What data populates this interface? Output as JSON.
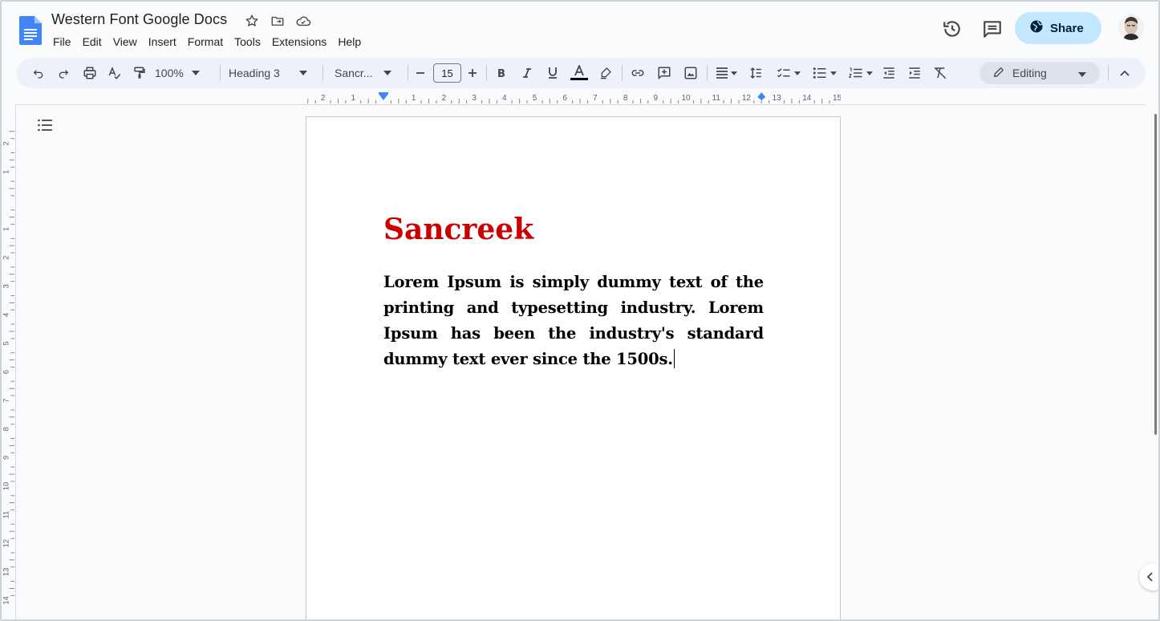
{
  "document": {
    "title": "Western Font Google Docs",
    "heading": "Sancreek",
    "body": "Lorem Ipsum is simply dummy text of the printing and typesetting industry. Lorem Ipsum has been the industry's standard dummy text ever since the 1500s."
  },
  "menu": [
    "File",
    "Edit",
    "View",
    "Insert",
    "Format",
    "Tools",
    "Extensions",
    "Help"
  ],
  "header": {
    "share_label": "Share",
    "icons": [
      "star-icon",
      "move-to-folder-icon",
      "cloud-saved-icon",
      "version-history-icon",
      "comments-icon"
    ]
  },
  "toolbar": {
    "zoom": "100%",
    "style": "Heading 3",
    "font": "Sancr...",
    "font_size": "15",
    "mode": "Editing"
  },
  "ruler": {
    "h_ticks": [
      "2",
      "1",
      "1",
      "2",
      "3",
      "4",
      "5",
      "6",
      "7",
      "8",
      "9",
      "10",
      "11",
      "12",
      "13",
      "14",
      "15"
    ],
    "v_ticks": [
      "2",
      "1",
      "1",
      "2",
      "3",
      "4",
      "5",
      "6",
      "7",
      "8",
      "9",
      "10",
      "11",
      "12",
      "13",
      "14"
    ]
  },
  "colors": {
    "heading": "#cc0000",
    "share_bg": "#c2e7ff",
    "toolbar_bg": "#edf2fa",
    "docs_blue": "#4285f4"
  }
}
